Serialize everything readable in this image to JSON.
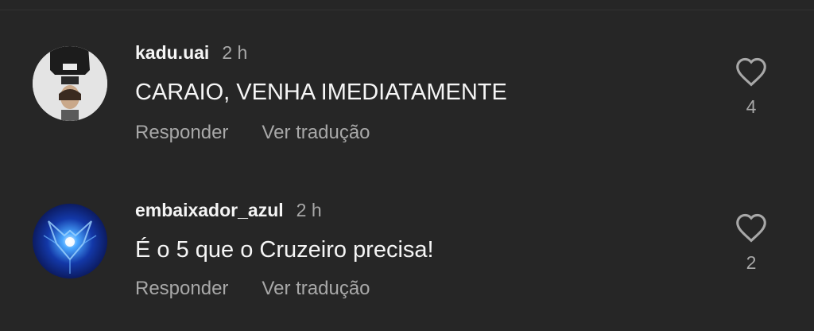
{
  "comments": [
    {
      "username": "kadu.uai",
      "time": "2 h",
      "text": "CARAIO, VENHA IMEDIATAMENTE",
      "reply_label": "Responder",
      "translate_label": "Ver tradução",
      "likes": "4",
      "avatar": "user-photo-avatar"
    },
    {
      "username": "embaixador_azul",
      "time": "2 h",
      "text": "É o 5 que o Cruzeiro precisa!",
      "reply_label": "Responder",
      "translate_label": "Ver tradução",
      "likes": "2",
      "avatar": "blue-fox-avatar"
    }
  ],
  "colors": {
    "background": "#262626",
    "primary_text": "#f5f5f5",
    "secondary_text": "#a8a8a8"
  }
}
